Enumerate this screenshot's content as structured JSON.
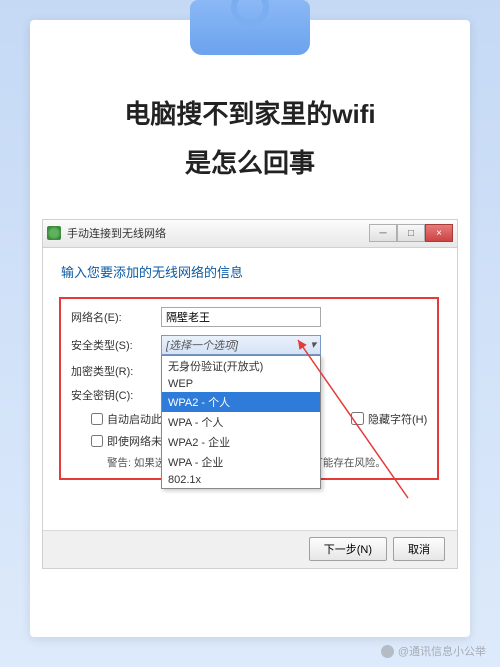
{
  "headline": {
    "line1": "电脑搜不到家里的wifi",
    "line2": "是怎么回事"
  },
  "window": {
    "title": "手动连接到无线网络",
    "min": "─",
    "max": "□",
    "close": "×"
  },
  "dialog": {
    "heading": "输入您要添加的无线网络的信息",
    "labels": {
      "network_name": "网络名(E):",
      "security_type": "安全类型(S):",
      "encryption_type": "加密类型(R):",
      "security_key": "安全密钥(C):"
    },
    "fields": {
      "network_name_value": "隔壁老王",
      "security_placeholder": "[选择一个选项]"
    },
    "dropdown_options": [
      "无身份验证(开放式)",
      "WEP",
      "WPA2 - 个人",
      "WPA - 个人",
      "WPA2 - 企业",
      "WPA - 企业",
      "802.1x"
    ],
    "dropdown_selected_index": 2,
    "hide_chars": "隐藏字符(H)",
    "auto_connect": "自动启动此连接(T)",
    "connect_hidden": "即使网络未进行广播也连接(O)",
    "warning": "警告: 如果选择此选项，则计算机的隐私信息可能存在风险。",
    "buttons": {
      "next": "下一步(N)",
      "cancel": "取消"
    }
  },
  "watermark": "@通讯信息小公举"
}
